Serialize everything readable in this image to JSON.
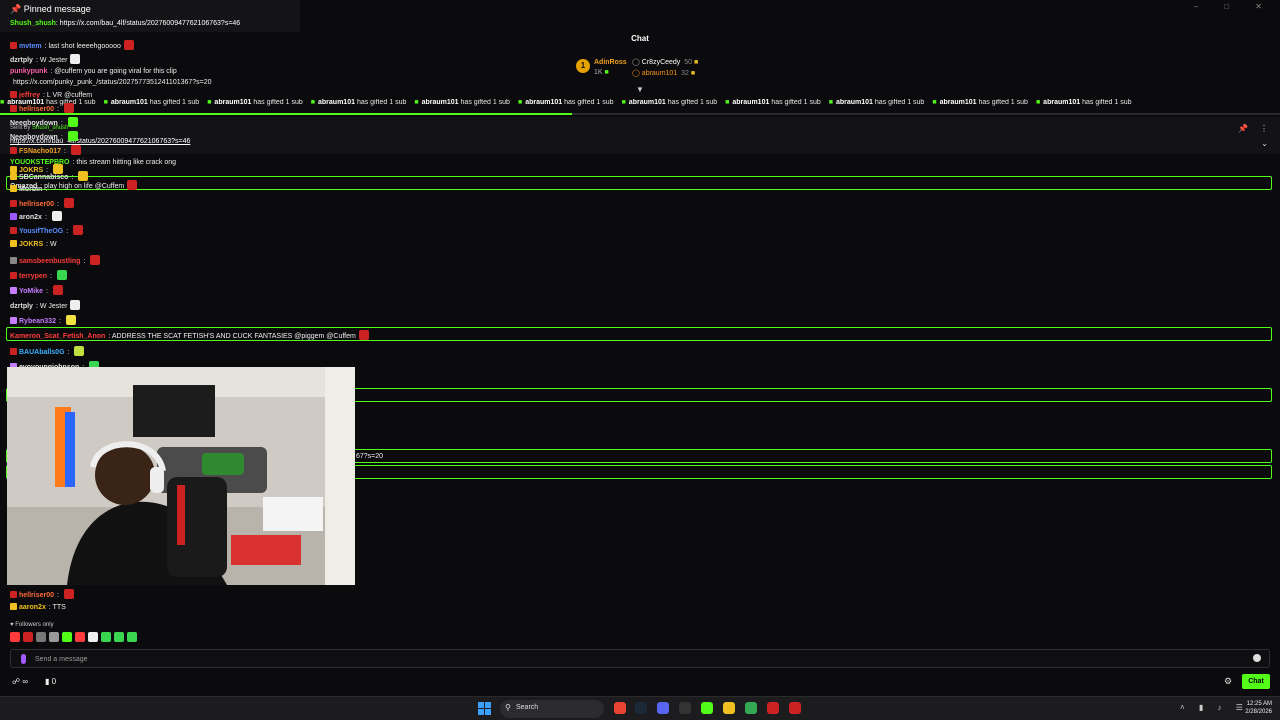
{
  "pinned": {
    "header": "Pinned message",
    "user": "Shush_shush",
    "text": "https://x.com/bau_4lf/status/2027600947762106763?s=46"
  },
  "chat_title": "Chat",
  "leaderboard": {
    "rank": "1",
    "first_name": "AdinRoss",
    "first_count": "1K",
    "second_name": "Cr8zyCeedy",
    "second_count": "50",
    "third_name": "abraum101",
    "third_count": "32"
  },
  "gift_bar": {
    "user": "abraum101",
    "text": "has gifted 1 sub"
  },
  "pin_row": {
    "sent_by_label": "Sent by",
    "sent_by_user": "Shush_shush",
    "link": "https://x.com/bau_4lf/status/2027600947762106763?s=46"
  },
  "messages": [
    {
      "user": "mvtem",
      "text": "last shot leeeehgooooo",
      "color": "#5b8cff"
    },
    {
      "user": "dzrtply",
      "text": "W Jester",
      "color": "#e0e0e0"
    },
    {
      "user": "punkypunk",
      "text": "@cuffem you are going viral for this clip",
      "color": "#ff5fa8"
    },
    {
      "user": "",
      "text": "https://x.com/punky_punk_/status/2027577351241101367?s=20",
      "color": "#e0e0e0"
    },
    {
      "user": "jeffrey",
      "text": "L VR @cuffem",
      "color": "#ff3b3b"
    },
    {
      "user": "hellriser00",
      "text": "",
      "color": "#ff6b3b"
    },
    {
      "user": "Neegboydown",
      "text": "",
      "color": "#e0e0e0"
    },
    {
      "user": "Neegboydown",
      "text": "",
      "color": "#e0e0e0"
    },
    {
      "user": "FSNacho017",
      "text": "",
      "color": "#f0a020"
    },
    {
      "user": "YOUOKSTEPBRO",
      "text": "this stream hitting like crack ong",
      "color": "#53fc18"
    },
    {
      "user": "JOKRS",
      "text": "",
      "color": "#f0c020"
    },
    {
      "user": "SBCannabisco",
      "text": "",
      "color": "#e0e0e0"
    },
    {
      "user": "Omazed",
      "text": "play high on life @Cuffem",
      "color": "#e0e0e0"
    },
    {
      "user": "Morbin",
      "text": "",
      "color": "#e0e0e0"
    },
    {
      "user": "hellriser00",
      "text": "",
      "color": "#ff6b3b"
    },
    {
      "user": "aron2x",
      "text": "",
      "color": "#e0e0e0"
    },
    {
      "user": "YousifTheOG",
      "text": "",
      "color": "#5b8cff"
    },
    {
      "user": "JOKRS",
      "text": "W",
      "color": "#f0c020"
    },
    {
      "user": "samsbeenbustling",
      "text": "",
      "color": "#ff3b3b"
    },
    {
      "user": "terrypen",
      "text": "",
      "color": "#ff3b3b"
    },
    {
      "user": "YoMike",
      "text": "",
      "color": "#c77dff"
    },
    {
      "user": "dzrtply",
      "text": "W Jester",
      "color": "#e0e0e0"
    },
    {
      "user": "Rybean332",
      "text": "",
      "color": "#c77dff"
    },
    {
      "user": "Kameron_Scat_Fetish_Anon",
      "text": "ADDRESS THE SCAT FETISH'S AND CUCK FANTASIES @piggem @Cuffem",
      "color": "#ff3b3b"
    },
    {
      "user": "BAUAballs0G",
      "text": "",
      "color": "#3bb0ff"
    },
    {
      "user": "evoyoungjohnson",
      "text": "",
      "color": "#e0e0e0"
    }
  ],
  "hidden_fragment": "67?s=20",
  "bottom_messages": [
    {
      "user": "hellriser00",
      "text": "",
      "color": "#ff6b3b"
    },
    {
      "user": "aaron2x",
      "text": "TTS",
      "color": "#f0c020"
    }
  ],
  "followers_only": "Followers only",
  "input_placeholder": "Send a message",
  "bottom_left_count": "0",
  "chat_button": "Chat",
  "taskbar": {
    "search": "Search",
    "time": "12:25 AM",
    "date": "2/28/2026"
  },
  "colors": {
    "accent": "#53fc18",
    "background": "#0b0b0d"
  }
}
